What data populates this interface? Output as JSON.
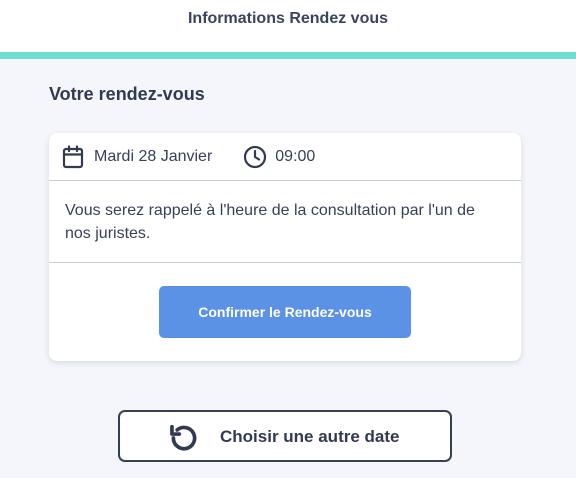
{
  "header": {
    "title": "Informations Rendez vous"
  },
  "section": {
    "title": "Votre rendez-vous"
  },
  "appointment": {
    "date": "Mardi 28 Janvier",
    "time": "09:00",
    "message": "Vous serez rappelé à l'heure de la consultation par l'un de nos juristes.",
    "confirm_label": "Confirmer le Rendez-vous"
  },
  "actions": {
    "other_date_label": "Choisir une autre date"
  },
  "icons": {
    "date": "calendar-icon",
    "time": "clock-icon",
    "other_date": "rotate-ccw-icon"
  },
  "colors": {
    "accent_bar": "#6cddd2",
    "primary_button": "#5b92e5",
    "text_dark": "#323a52",
    "background": "#f4f6fb"
  }
}
